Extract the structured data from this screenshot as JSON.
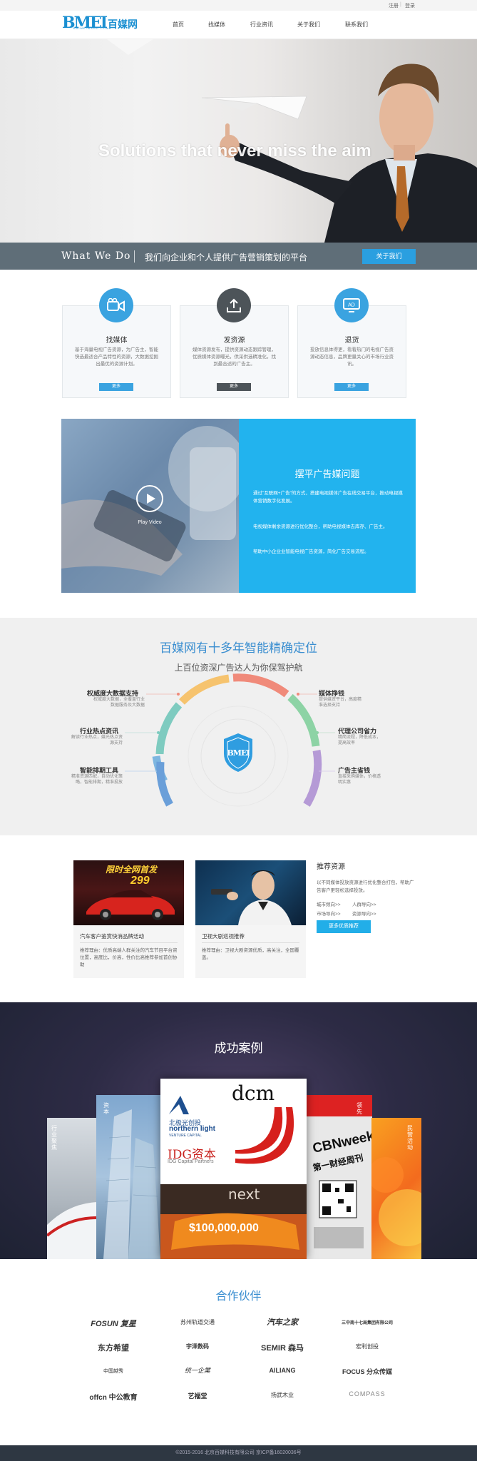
{
  "topbar": {
    "register": "注册",
    "separator": "|",
    "login": "登录"
  },
  "header": {
    "logo_mark": "BMEI",
    "logo_text": "百媒网",
    "logo_sub": "BAIMEIWANG.COM",
    "nav": [
      "首页",
      "找媒体",
      "行业资讯",
      "关于我们",
      "联系我们"
    ]
  },
  "hero": {
    "title": "Solutions that never miss the aim",
    "strip_what": "What We Do",
    "strip_desc": "我们向企业和个人提供广告营销策划的平台",
    "strip_button": "关于我们"
  },
  "services": [
    {
      "title": "找媒体",
      "desc": "基于海量电视广告资源，为广告主，智能快选最适合产品特性的资源，大数据挖掘出最优的资源计划。",
      "button": "更多",
      "icon": "video-camera-icon",
      "color": "#3aa3e0"
    },
    {
      "title": "发资源",
      "desc": "媒体资源发布，提供资源动态跟踪管理，优质媒体资源曝光，供采供选精准化，找到最合适的广告主。",
      "button": "更多",
      "icon": "upload-icon",
      "color": "#4d5459"
    },
    {
      "title": "退货",
      "desc": "投放信息体得更，看看热门的电视广告资源动态信息，品牌更量关心的市场行业资讯。",
      "button": "更多",
      "icon": "ad-display-icon",
      "color": "#3aa3e0"
    }
  ],
  "video": {
    "play_label": "Play Video"
  },
  "problem": {
    "title": "摆平广告媒问题",
    "paragraphs": [
      "通过\"互联网+广告\"的方式，搭建电视媒体广告在线交易平台，推动电视媒体营销数字化发展。",
      "电视媒体剩余资源进行优化整合，帮助电视媒体去库存、广告主。",
      "帮助中小企业业智能电视广告资源，简化广告交易流程。"
    ]
  },
  "positioning": {
    "title": "百媒网有十多年智能精确定位",
    "subtitle": "上百位资深广告达人为你保驾护航",
    "left": [
      {
        "title": "权威度大数据支持",
        "desc": "权威度大数据，全覆盖行业数据服务及大数据"
      },
      {
        "title": "行业热点资讯",
        "desc": "解读行业热点，媒光热点资源支持"
      },
      {
        "title": "智能排期工具",
        "desc": "精准资源匹配，自动优化策略，智能排期，精准投放"
      }
    ],
    "right": [
      {
        "title": "媒体挣钱",
        "desc": "提供媒资平台，高度精准选择支持"
      },
      {
        "title": "代理公司省力",
        "desc": "精简流程，降低成本，提高效率"
      },
      {
        "title": "广告主省钱",
        "desc": "直接采购媒体，价格透明实惠"
      }
    ],
    "badge": "BMEI"
  },
  "recommend": {
    "cards": [
      {
        "banner_text": "限时全网首发",
        "price": "299",
        "caption": "汽车客户鉴赏快消品牌活动",
        "desc": "推荐理由：优质高端人群关注的汽车节目平台资位置，高度比，价高，性价比高推荐参加首创协助"
      },
      {
        "caption": "卫视大剧巡视推荐",
        "desc": "推荐理由：卫视大剧资源优质，高关注，全国覆盖。"
      }
    ],
    "heading": "推荐资源",
    "text": "以不同媒体投放资源进行优化整合打包，帮助广告客户更轻松选择投放。",
    "links": [
      "城市频向>>",
      "人群导向>>",
      "市场导向>>",
      "资源导向>>"
    ],
    "button": "更多优质推荐"
  },
  "cases": {
    "title": "成功案例",
    "panel_labels": [
      "行业聚焦",
      "资本",
      "领先",
      "民营活动"
    ],
    "idg_cn": "IDG资本",
    "idg_en": "IDG Capital Partners",
    "dcm": "dcm",
    "northern_cn": "北极光创投",
    "northern_en": "northern light",
    "northern_sub": "VENTURE CAPITAL",
    "next": "next",
    "money": "$100,000,000",
    "cbn": "CBNweek",
    "cbn_cn": "第一财经周刊"
  },
  "partners": {
    "title": "合作伙伴",
    "logos": [
      [
        "FOSUN 复星",
        "苏州轨道交通",
        "汽车之家",
        "三中南十七局集团有限公司"
      ],
      [
        "东方希望",
        "宇泽数码",
        "SEMIR 森马",
        "宏利创投"
      ],
      [
        "中国越秀",
        "统一企業",
        "AILIANG",
        "FOCUS 分众传媒"
      ],
      [
        "offcn 中公教育",
        "艺福堂",
        "扬武木业",
        "COMPASS"
      ]
    ]
  },
  "footer": {
    "text": "©2015-2016 北京百媒科技有限公司 京ICP备16020036号"
  },
  "colors": {
    "accent": "#22b3ee",
    "brand": "#1a8fd1",
    "dark": "#2e3742"
  }
}
